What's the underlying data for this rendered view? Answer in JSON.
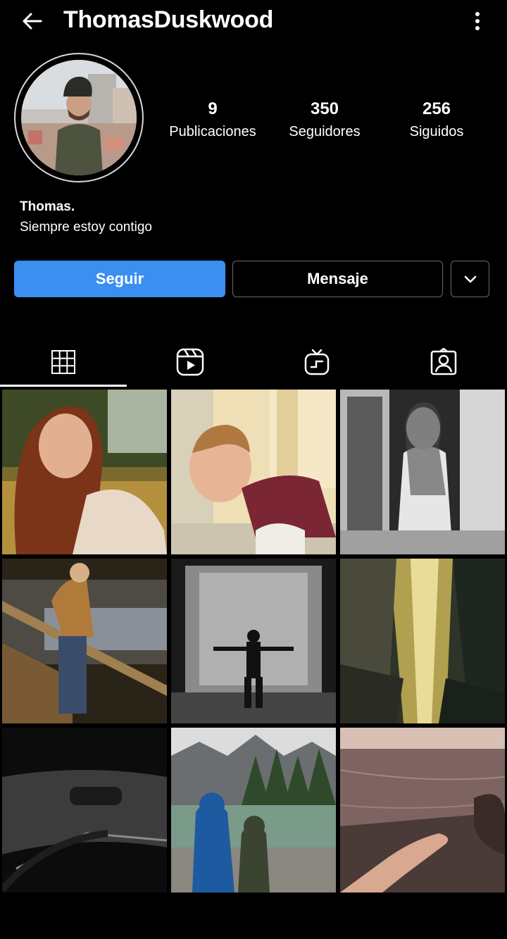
{
  "header": {
    "username": "ThomasDuskwood"
  },
  "stats": [
    {
      "value": "9",
      "label": "Publicaciones"
    },
    {
      "value": "350",
      "label": "Seguidores"
    },
    {
      "value": "256",
      "label": "Siguidos"
    }
  ],
  "bio": {
    "name": "Thomas.",
    "text": "Siempre estoy contigo"
  },
  "actions": {
    "follow_label": "Seguir",
    "message_label": "Mensaje"
  },
  "tabs": [
    {
      "icon": "grid-icon",
      "active": true
    },
    {
      "icon": "reels-icon",
      "active": false
    },
    {
      "icon": "igtv-icon",
      "active": false
    },
    {
      "icon": "tagged-icon",
      "active": false
    }
  ],
  "posts": [
    {
      "subject": "woman with red hair in golden field"
    },
    {
      "subject": "smiling woman sitting by building"
    },
    {
      "subject": "black and white woman by glass door"
    },
    {
      "subject": "man on wooden dock by lake"
    },
    {
      "subject": "man in rain room silhouette"
    },
    {
      "subject": "sunlight through rocky canyon"
    },
    {
      "subject": "car windshield dark road"
    },
    {
      "subject": "couple hooded by mountain lake"
    },
    {
      "subject": "hand touching calm water at sunset"
    }
  ],
  "colors": {
    "accent": "#3b8ff0",
    "background": "#000000",
    "border": "#6a6a6a"
  }
}
